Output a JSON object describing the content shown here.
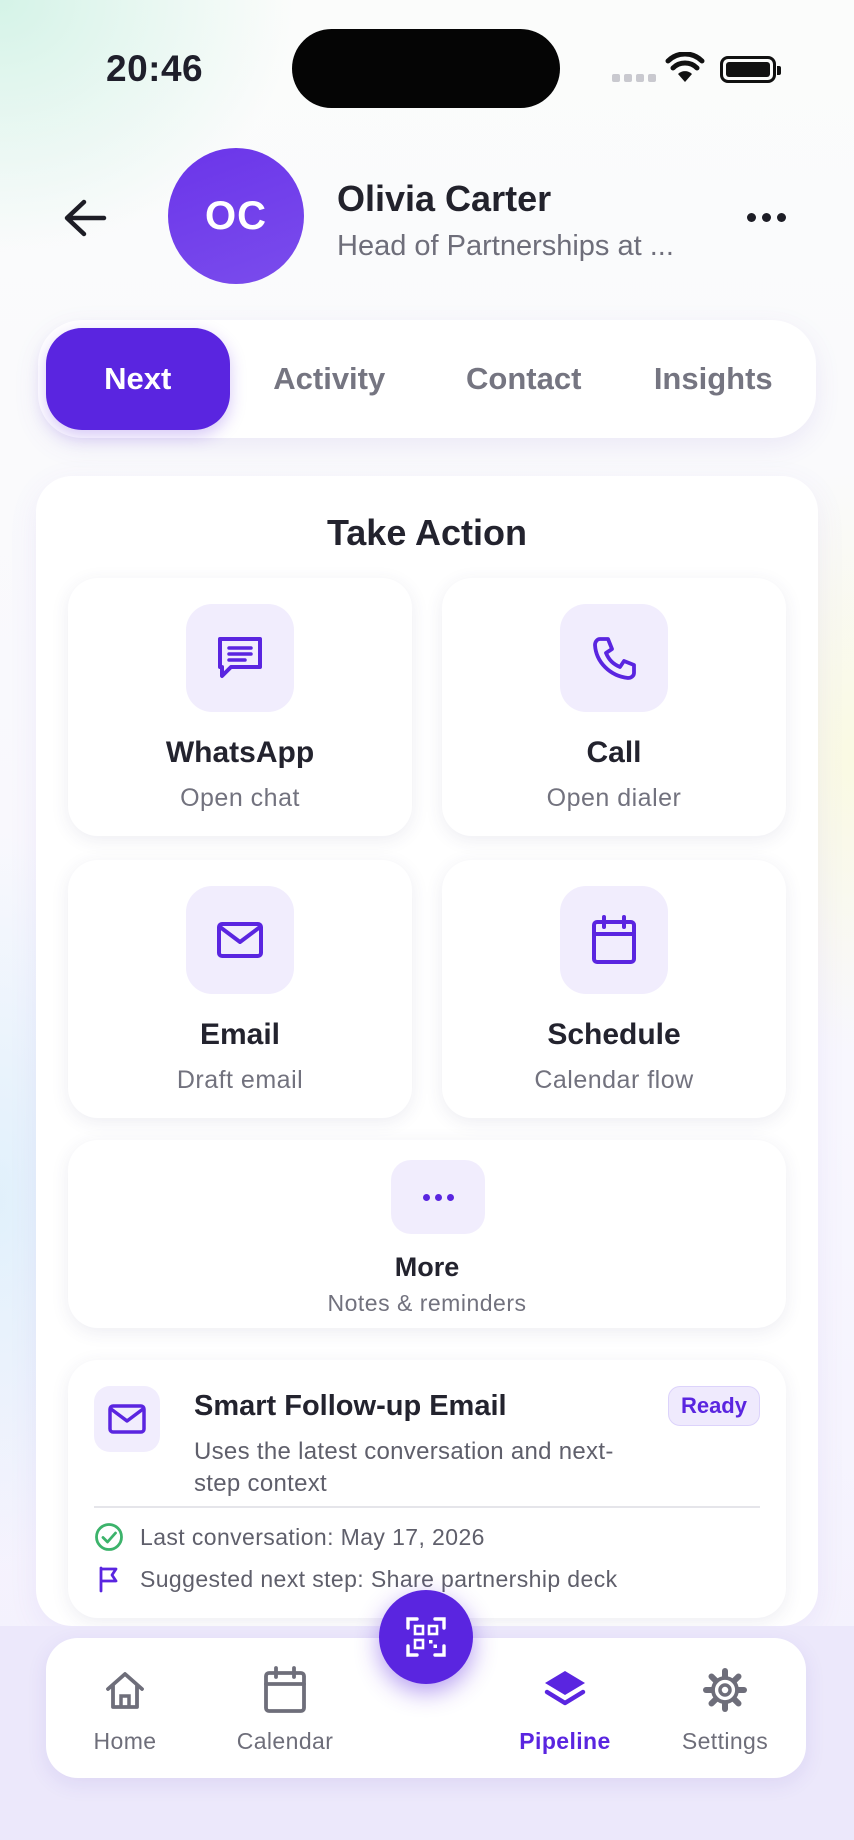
{
  "status_bar": {
    "time": "20:46"
  },
  "contact": {
    "initials": "OC",
    "name": "Olivia Carter",
    "role": "Head of Partnerships at ..."
  },
  "tabs": [
    {
      "label": "Next",
      "active": true
    },
    {
      "label": "Activity"
    },
    {
      "label": "Contact"
    },
    {
      "label": "Insights"
    }
  ],
  "take_action": {
    "title": "Take Action",
    "actions": [
      {
        "label": "WhatsApp",
        "sub": "Open chat",
        "icon": "chat-icon"
      },
      {
        "label": "Call",
        "sub": "Open dialer",
        "icon": "phone-icon"
      },
      {
        "label": "Email",
        "sub": "Draft email",
        "icon": "mail-icon"
      },
      {
        "label": "Schedule",
        "sub": "Calendar flow",
        "icon": "calendar-icon"
      }
    ],
    "more": {
      "label": "More",
      "sub": "Notes & reminders",
      "icon": "ellipsis-icon"
    }
  },
  "followup": {
    "title": "Smart Follow-up Email",
    "badge": "Ready",
    "description": "Uses the latest conversation and next-step context",
    "last_conversation": "Last conversation: May 17, 2026",
    "next_step": "Suggested next step: Share partnership deck"
  },
  "nav": {
    "items": [
      {
        "label": "Home",
        "icon": "home-icon"
      },
      {
        "label": "Calendar",
        "icon": "calendar-icon"
      },
      {
        "label": "Pipeline",
        "icon": "layers-icon",
        "active": true
      },
      {
        "label": "Settings",
        "icon": "gear-icon"
      }
    ],
    "fab_icon": "qr-scan-icon"
  },
  "colors": {
    "accent": "#5a25e0",
    "accent_soft": "#f1edfd",
    "success": "#3cb36b",
    "text": "#23232e",
    "muted": "#72727e"
  }
}
